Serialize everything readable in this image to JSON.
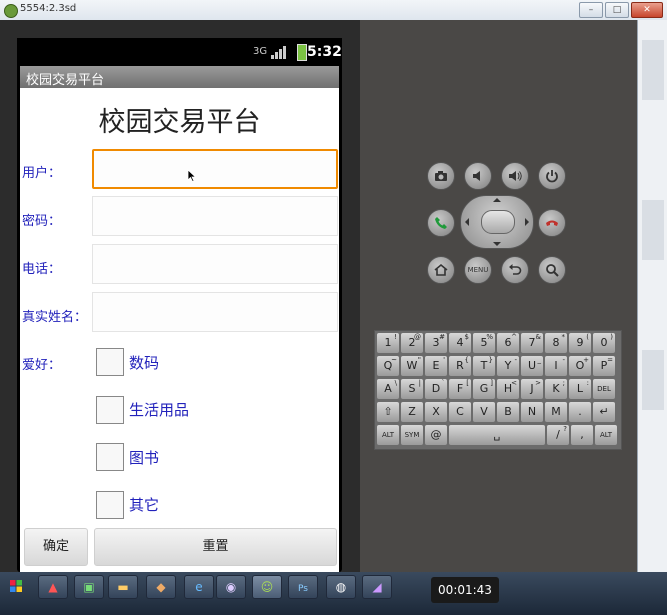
{
  "window": {
    "title": "5554:2.3sd",
    "controls": [
      "–",
      "□",
      "✕"
    ]
  },
  "status_bar": {
    "network": "3G",
    "time": "5:32",
    "colors": {
      "battery": "#7bc243"
    }
  },
  "app": {
    "title_bar": "校园交易平台",
    "heading": "校园交易平台",
    "form": {
      "user_label": "用户：",
      "user_value": "",
      "password_label": "密码：",
      "password_value": "",
      "phone_label": "电话：",
      "phone_value": "",
      "realname_label": "真实姓名：",
      "realname_value": ""
    },
    "hobbies": {
      "label": "爱好：",
      "options": [
        {
          "label": "数码",
          "checked": false
        },
        {
          "label": "生活用品",
          "checked": false
        },
        {
          "label": "图书",
          "checked": false
        },
        {
          "label": "其它",
          "checked": false
        }
      ]
    },
    "buttons": {
      "confirm": "确定",
      "reset": "重置"
    },
    "colors": {
      "label": "#2222bb",
      "focus": "#f08a00"
    }
  },
  "emulator_controls": {
    "row1": [
      "camera-icon",
      "volume-down-icon",
      "volume-up-icon",
      "power-icon"
    ],
    "row2": [
      "call-icon",
      "dpad",
      "end-call-icon"
    ],
    "row3": [
      "home-icon",
      "MENU",
      "back-icon",
      "search-icon"
    ]
  },
  "keyboard": {
    "rows": [
      [
        [
          "1",
          "!"
        ],
        [
          "2",
          "@"
        ],
        [
          "3",
          "#"
        ],
        [
          "4",
          "$"
        ],
        [
          "5",
          "%"
        ],
        [
          "6",
          "^"
        ],
        [
          "7",
          "&"
        ],
        [
          "8",
          "*"
        ],
        [
          "9",
          "("
        ],
        [
          "0",
          ")"
        ]
      ],
      [
        [
          "Q",
          "~"
        ],
        [
          "W",
          "\""
        ],
        [
          "E",
          "'"
        ],
        [
          "R",
          "{"
        ],
        [
          "T",
          "}"
        ],
        [
          "Y",
          "-"
        ],
        [
          "U",
          "_"
        ],
        [
          "I",
          "-"
        ],
        [
          "O",
          "+"
        ],
        [
          "P",
          "="
        ]
      ],
      [
        [
          "A",
          "\\"
        ],
        [
          "S",
          "|"
        ],
        [
          "D",
          "`"
        ],
        [
          "F",
          "["
        ],
        [
          "G",
          "]"
        ],
        [
          "H",
          "<"
        ],
        [
          "J",
          ">"
        ],
        [
          "K",
          ";"
        ],
        [
          "L",
          ":"
        ],
        [
          "DEL",
          ""
        ]
      ],
      [
        [
          "⇧",
          ""
        ],
        [
          "Z",
          ""
        ],
        [
          "X",
          ""
        ],
        [
          "C",
          ""
        ],
        [
          "V",
          ""
        ],
        [
          "B",
          ""
        ],
        [
          "N",
          ""
        ],
        [
          "M",
          ""
        ],
        [
          ".",
          ""
        ],
        [
          "↵",
          ""
        ]
      ],
      [
        [
          "ALT",
          ""
        ],
        [
          "SYM",
          ""
        ],
        [
          "@",
          ""
        ],
        [
          "␣",
          ""
        ],
        [
          "/",
          "?"
        ],
        [
          ",",
          ""
        ],
        [
          "ALT",
          ""
        ]
      ]
    ]
  },
  "taskbar": {
    "timer": "00:01:43"
  }
}
